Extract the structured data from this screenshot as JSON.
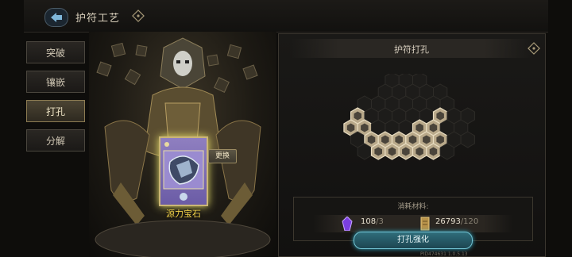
{
  "header": {
    "title": "护符工艺"
  },
  "sidebar": {
    "tabs": [
      {
        "label": "突破",
        "active": false
      },
      {
        "label": "镶嵌",
        "active": false
      },
      {
        "label": "打孔",
        "active": true
      },
      {
        "label": "分解",
        "active": false
      }
    ]
  },
  "gem_card": {
    "swap_label": "更换",
    "name": "源力宝石"
  },
  "panel": {
    "title": "护符打孔",
    "cost_label": "消耗材料:",
    "materials": [
      {
        "icon": "purple-crystal-icon",
        "have": "108",
        "need": "/3"
      },
      {
        "icon": "scroll-icon",
        "have": "26793",
        "need": "/120"
      }
    ],
    "action_label": "打孔强化",
    "build_id": "PID474631  1.0.5.13"
  },
  "colors": {
    "accent": "#74c6d6",
    "gold": "#f3d34a",
    "active_tab": "#8c7b52"
  }
}
